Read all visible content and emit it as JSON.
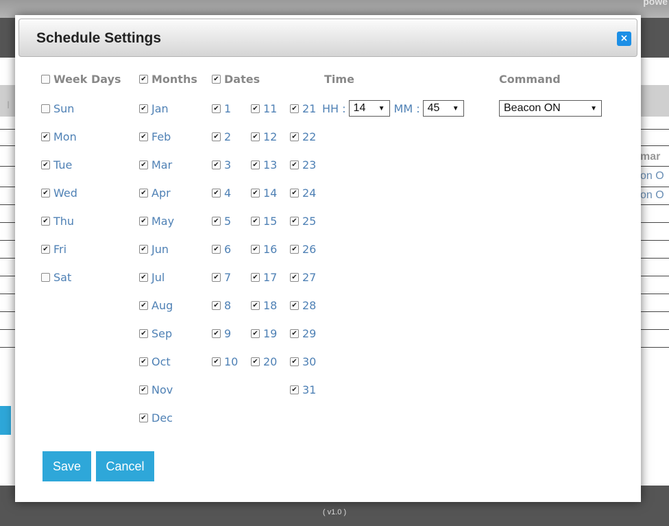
{
  "background": {
    "powered_text": "powe",
    "col_header": "mar",
    "cells": [
      "on O",
      "on O"
    ],
    "left_mark": "I",
    "version": "( v1.0 )"
  },
  "modal": {
    "title": "Schedule Settings",
    "close_label": "×",
    "headers": {
      "week_days": "Week Days",
      "months": "Months",
      "dates": "Dates",
      "time": "Time",
      "command": "Command"
    },
    "header_checked": {
      "week_days": false,
      "months": true,
      "dates": true
    },
    "week_days": [
      {
        "label": "Sun",
        "checked": false
      },
      {
        "label": "Mon",
        "checked": true
      },
      {
        "label": "Tue",
        "checked": true
      },
      {
        "label": "Wed",
        "checked": true
      },
      {
        "label": "Thu",
        "checked": true
      },
      {
        "label": "Fri",
        "checked": true
      },
      {
        "label": "Sat",
        "checked": false
      }
    ],
    "months": [
      {
        "label": "Jan",
        "checked": true
      },
      {
        "label": "Feb",
        "checked": true
      },
      {
        "label": "Mar",
        "checked": true
      },
      {
        "label": "Apr",
        "checked": true
      },
      {
        "label": "May",
        "checked": true
      },
      {
        "label": "Jun",
        "checked": true
      },
      {
        "label": "Jul",
        "checked": true
      },
      {
        "label": "Aug",
        "checked": true
      },
      {
        "label": "Sep",
        "checked": true
      },
      {
        "label": "Oct",
        "checked": true
      },
      {
        "label": "Nov",
        "checked": true
      },
      {
        "label": "Dec",
        "checked": true
      }
    ],
    "dates_col1": [
      "1",
      "2",
      "3",
      "4",
      "5",
      "6",
      "7",
      "8",
      "9",
      "10"
    ],
    "dates_col2": [
      "11",
      "12",
      "13",
      "14",
      "15",
      "16",
      "17",
      "18",
      "19",
      "20"
    ],
    "dates_col3": [
      "21",
      "22",
      "23",
      "24",
      "25",
      "26",
      "27",
      "28",
      "29",
      "30",
      "31"
    ],
    "time": {
      "hh_label": "HH :",
      "hh_value": "14",
      "mm_label": "MM :",
      "mm_value": "45"
    },
    "command": {
      "value": "Beacon ON"
    },
    "buttons": {
      "save": "Save",
      "cancel": "Cancel"
    }
  }
}
